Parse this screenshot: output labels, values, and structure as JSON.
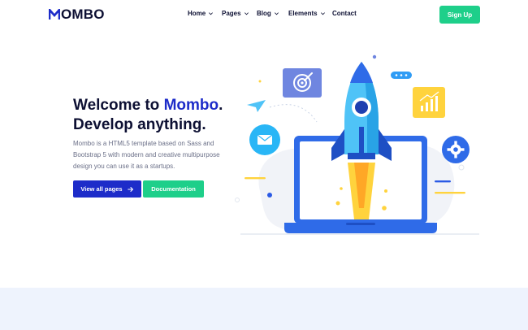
{
  "header": {
    "logo_text": "MOMBO",
    "logo_mark_letter": "M",
    "logo_rest": "OMBO",
    "nav": [
      {
        "label": "Home",
        "has_dropdown": true
      },
      {
        "label": "Pages",
        "has_dropdown": true
      },
      {
        "label": "Blog",
        "has_dropdown": true
      },
      {
        "label": "Elements",
        "has_dropdown": true
      },
      {
        "label": "Contact",
        "has_dropdown": false
      }
    ],
    "signup_label": "Sign Up"
  },
  "hero": {
    "title_prefix": "Welcome to ",
    "title_brand": "Mombo",
    "title_suffix": ".",
    "title_line2": "Develop anything.",
    "description": "Mombo is a HTML5 template based on Sass and Bootstrap 5 with modern and creative multipurpose design you can use it as a startups.",
    "primary_button": "View all pages",
    "secondary_button": "Documentation"
  },
  "icons": {
    "primary_button_icon": "arrow-right-icon",
    "illustration": "rocket-laptop-illustration"
  },
  "colors": {
    "brand_blue": "#1d2cc9",
    "accent_green": "#1ecf8a",
    "dark_text": "#0d1033",
    "muted_text": "#6b7088",
    "band_bg": "#eef3fd"
  }
}
